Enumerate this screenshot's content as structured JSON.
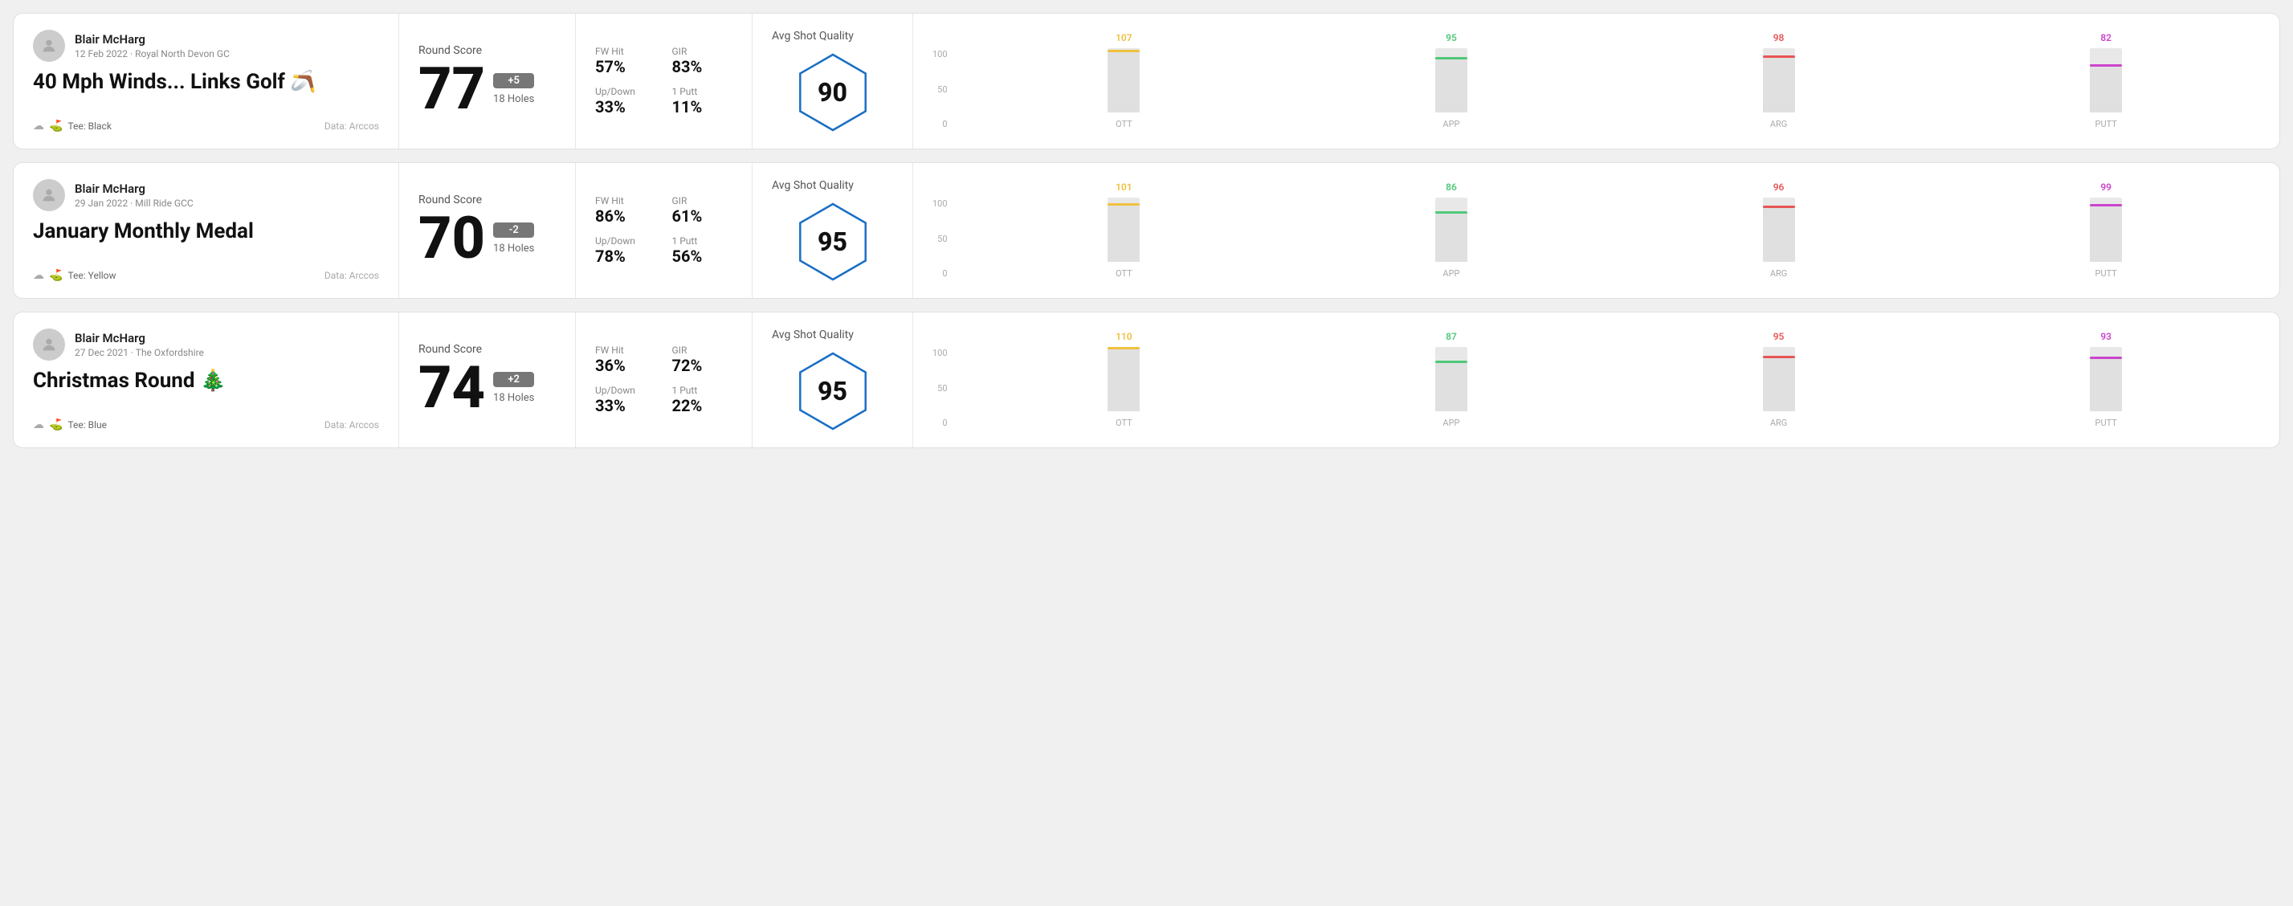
{
  "rounds": [
    {
      "id": "round1",
      "player": "Blair McHarg",
      "date_course": "12 Feb 2022 · Royal North Devon GC",
      "title": "40 Mph Winds... Links Golf",
      "title_emoji": "🪃",
      "tee": "Black",
      "data_source": "Data: Arccos",
      "score": "77",
      "score_diff": "+5",
      "holes": "18 Holes",
      "fw_hit_label": "FW Hit",
      "fw_hit_value": "57%",
      "gir_label": "GIR",
      "gir_value": "83%",
      "updown_label": "Up/Down",
      "updown_value": "33%",
      "oneputt_label": "1 Putt",
      "oneputt_value": "11%",
      "avg_quality_label": "Avg Shot Quality",
      "quality_score": "90",
      "chart": {
        "columns": [
          {
            "label": "OTT",
            "value": 107,
            "color": "#f0c040",
            "bar_pct": 75
          },
          {
            "label": "APP",
            "value": 95,
            "color": "#50c878",
            "bar_pct": 65
          },
          {
            "label": "ARG",
            "value": 98,
            "color": "#e85555",
            "bar_pct": 68
          },
          {
            "label": "PUTT",
            "value": 82,
            "color": "#cc44cc",
            "bar_pct": 55
          }
        ],
        "y_labels": [
          "100",
          "50",
          "0"
        ]
      }
    },
    {
      "id": "round2",
      "player": "Blair McHarg",
      "date_course": "29 Jan 2022 · Mill Ride GCC",
      "title": "January Monthly Medal",
      "title_emoji": "",
      "tee": "Yellow",
      "data_source": "Data: Arccos",
      "score": "70",
      "score_diff": "-2",
      "holes": "18 Holes",
      "fw_hit_label": "FW Hit",
      "fw_hit_value": "86%",
      "gir_label": "GIR",
      "gir_value": "61%",
      "updown_label": "Up/Down",
      "updown_value": "78%",
      "oneputt_label": "1 Putt",
      "oneputt_value": "56%",
      "avg_quality_label": "Avg Shot Quality",
      "quality_score": "95",
      "chart": {
        "columns": [
          {
            "label": "OTT",
            "value": 101,
            "color": "#f0c040",
            "bar_pct": 72
          },
          {
            "label": "APP",
            "value": 86,
            "color": "#50c878",
            "bar_pct": 58
          },
          {
            "label": "ARG",
            "value": 96,
            "color": "#e85555",
            "bar_pct": 67
          },
          {
            "label": "PUTT",
            "value": 99,
            "color": "#cc44cc",
            "bar_pct": 70
          }
        ],
        "y_labels": [
          "100",
          "50",
          "0"
        ]
      }
    },
    {
      "id": "round3",
      "player": "Blair McHarg",
      "date_course": "27 Dec 2021 · The Oxfordshire",
      "title": "Christmas Round",
      "title_emoji": "🎄",
      "tee": "Blue",
      "data_source": "Data: Arccos",
      "score": "74",
      "score_diff": "+2",
      "holes": "18 Holes",
      "fw_hit_label": "FW Hit",
      "fw_hit_value": "36%",
      "gir_label": "GIR",
      "gir_value": "72%",
      "updown_label": "Up/Down",
      "updown_value": "33%",
      "oneputt_label": "1 Putt",
      "oneputt_value": "22%",
      "avg_quality_label": "Avg Shot Quality",
      "quality_score": "95",
      "chart": {
        "columns": [
          {
            "label": "OTT",
            "value": 110,
            "color": "#f0c040",
            "bar_pct": 78
          },
          {
            "label": "APP",
            "value": 87,
            "color": "#50c878",
            "bar_pct": 59
          },
          {
            "label": "ARG",
            "value": 95,
            "color": "#e85555",
            "bar_pct": 66
          },
          {
            "label": "PUTT",
            "value": 93,
            "color": "#cc44cc",
            "bar_pct": 64
          }
        ],
        "y_labels": [
          "100",
          "50",
          "0"
        ]
      }
    }
  ]
}
